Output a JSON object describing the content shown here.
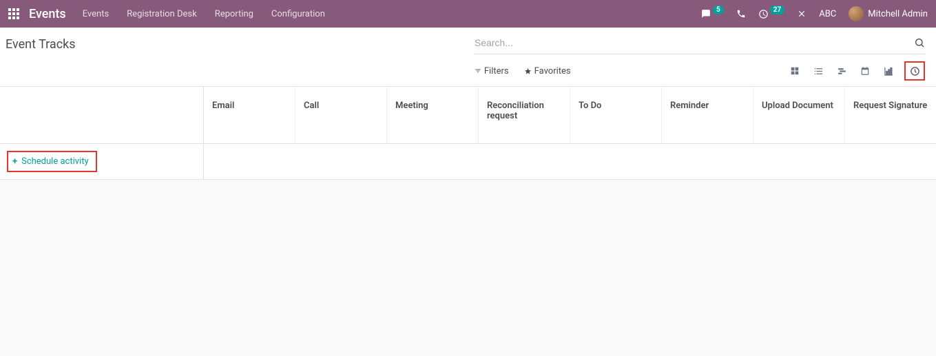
{
  "navbar": {
    "brand": "Events",
    "links": [
      "Events",
      "Registration Desk",
      "Reporting",
      "Configuration"
    ],
    "messages_count": "5",
    "activities_count": "27",
    "company": "ABC",
    "user": "Mitchell Admin"
  },
  "control": {
    "title": "Event Tracks",
    "search_placeholder": "Search...",
    "filters_label": "Filters",
    "favorites_label": "Favorites"
  },
  "columns": [
    "Email",
    "Call",
    "Meeting",
    "Reconciliation request",
    "To Do",
    "Reminder",
    "Upload Document",
    "Request Signature"
  ],
  "schedule_label": "Schedule activity"
}
